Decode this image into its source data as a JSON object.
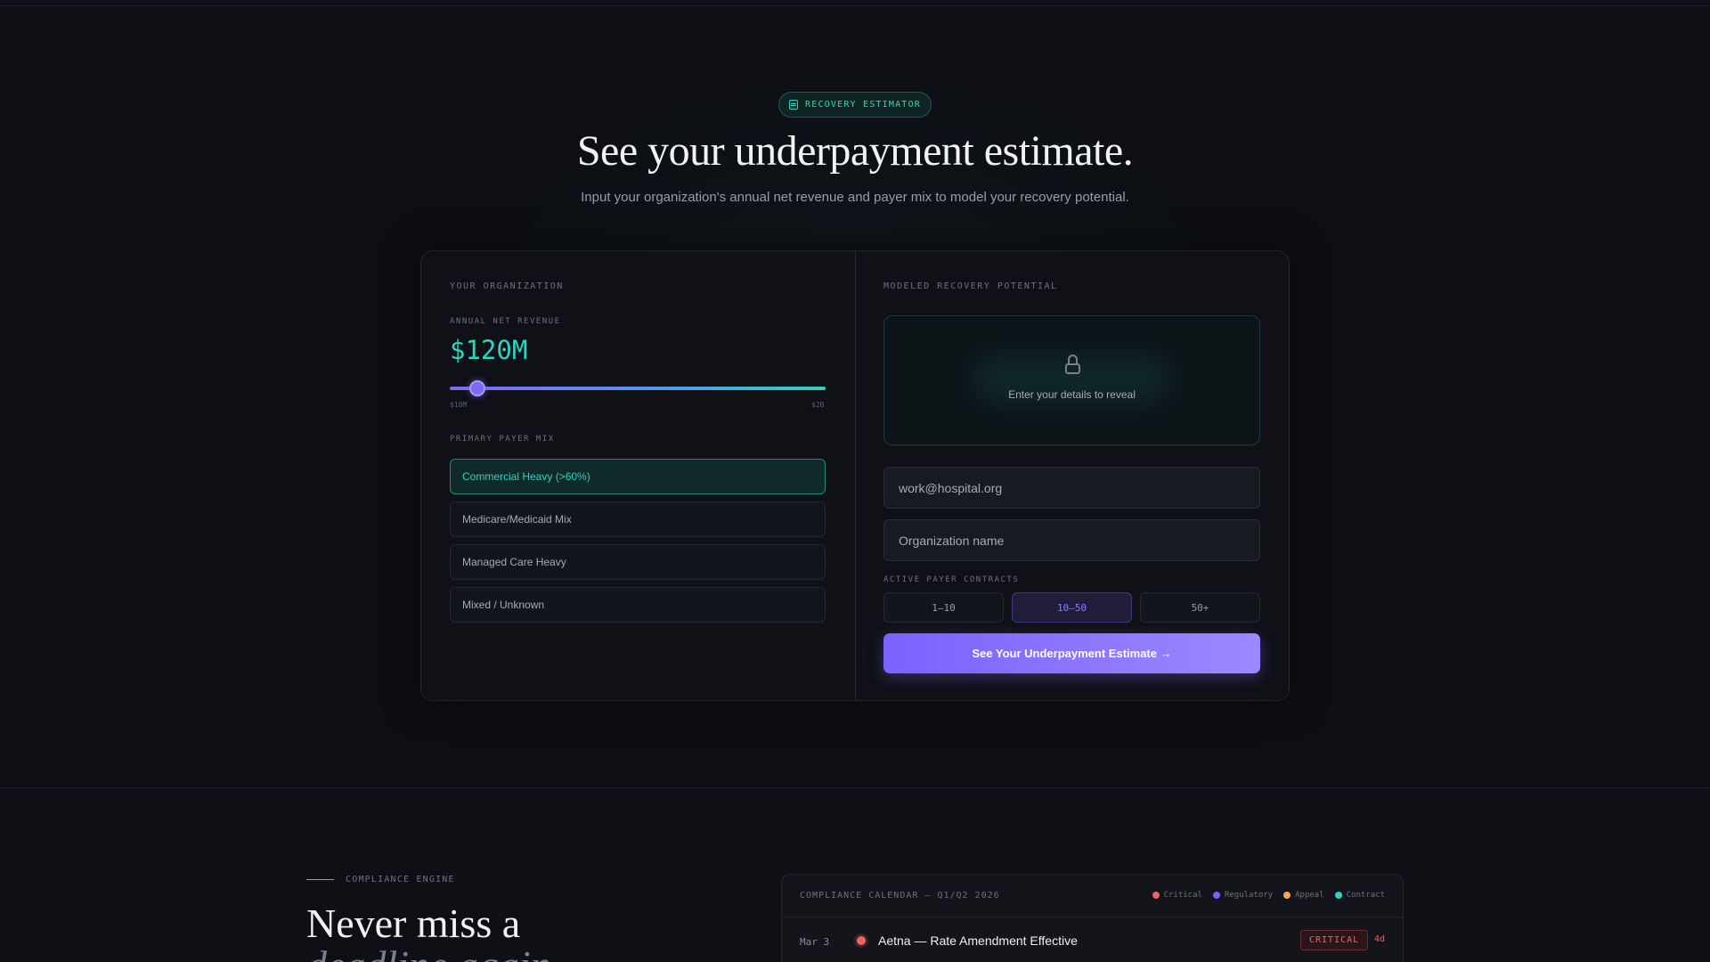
{
  "hero": {
    "badge": "RECOVERY ESTIMATOR",
    "badge_icon": "calculator-icon",
    "title": "See your underpayment estimate.",
    "subtitle": "Input your organization's annual net revenue and payer mix to model your recovery potential."
  },
  "org": {
    "section_label": "YOUR ORGANIZATION",
    "revenue_label": "ANNUAL NET REVENUE",
    "revenue_value": "$120M",
    "slider_min": "$10M",
    "slider_max": "$2B",
    "slider_position": 0.06,
    "payer_mix_label": "PRIMARY PAYER MIX",
    "payer_options": [
      "Commercial Heavy (>60%)",
      "Medicare/Medicaid Mix",
      "Managed Care Heavy",
      "Mixed / Unknown"
    ],
    "selected_payer": "Commercial Heavy (>60%)"
  },
  "recovery": {
    "section_label": "MODELED RECOVERY POTENTIAL",
    "locked_text": "Enter your details to reveal",
    "lock_icon": "lock-icon",
    "email_placeholder": "work@hospital.org",
    "org_placeholder": "Organization name",
    "contracts_label": "ACTIVE PAYER CONTRACTS",
    "contract_options": [
      "1–10",
      "10–50",
      "50+"
    ],
    "selected_contract": "10–50",
    "cta_label": "See Your Underpayment Estimate →"
  },
  "compliance": {
    "eyebrow": "COMPLIANCE ENGINE",
    "headline_line1": "Never miss a",
    "headline_line2": "deadline again.",
    "calendar_title": "COMPLIANCE CALENDAR — Q1/Q2 2026",
    "legend": [
      {
        "label": "Critical",
        "color": "#f06464"
      },
      {
        "label": "Regulatory",
        "color": "#7b61ff"
      },
      {
        "label": "Appeal",
        "color": "#f5a55a"
      },
      {
        "label": "Contract",
        "color": "#2dd4bf"
      }
    ],
    "rows": [
      {
        "date": "Mar 3",
        "title": "Aetna — Rate Amendment Effective",
        "badge": "CRITICAL",
        "days": "4d"
      }
    ]
  },
  "colors": {
    "accent_teal": "#2dd4bf",
    "accent_purple": "#7b61ff",
    "background": "#0d0f14"
  }
}
